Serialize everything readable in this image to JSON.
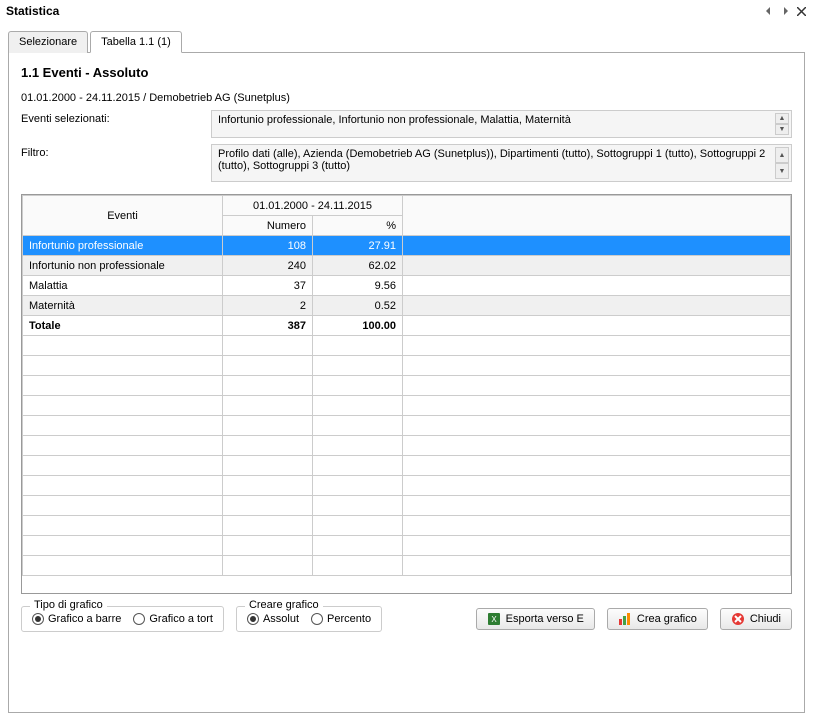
{
  "window": {
    "title": "Statistica"
  },
  "tabs": [
    {
      "label": "Selezionare",
      "active": false
    },
    {
      "label": "Tabella 1.1 (1)",
      "active": true
    }
  ],
  "section_title": "1.1 Eventi - Assoluto",
  "date_range_meta": "01.01.2000 - 24.11.2015 / Demobetrieb AG (Sunetplus)",
  "labels": {
    "eventi_selezionati": "Eventi selezionati:",
    "filtro": "Filtro:"
  },
  "eventi_selezionati_value": "Infortunio professionale, Infortunio non professionale, Malattia, Maternità",
  "filtro_value": "Profilo dati (alle), Azienda (Demobetrieb AG (Sunetplus)), Dipartimenti (tutto), Sottogruppi 1 (tutto), Sottogruppi 2 (tutto), Sottogruppi 3 (tutto)",
  "table": {
    "header_events": "Eventi",
    "header_period": "01.01.2000 - 24.11.2015",
    "header_numero": "Numero",
    "header_pct": "%",
    "rows": [
      {
        "label": "Infortunio professionale",
        "numero": "108",
        "pct": "27.91",
        "selected": true
      },
      {
        "label": "Infortunio non professionale",
        "numero": "240",
        "pct": "62.02",
        "alt": true
      },
      {
        "label": "Malattia",
        "numero": "37",
        "pct": "9.56"
      },
      {
        "label": "Maternità",
        "numero": "2",
        "pct": "0.52",
        "alt": true
      }
    ],
    "total": {
      "label": "Totale",
      "numero": "387",
      "pct": "100.00"
    },
    "empty_rows": 12
  },
  "chart_data": {
    "type": "table",
    "title": "1.1 Eventi - Assoluto",
    "period": "01.01.2000 - 24.11.2015",
    "categories": [
      "Infortunio professionale",
      "Infortunio non professionale",
      "Malattia",
      "Maternità"
    ],
    "series": [
      {
        "name": "Numero",
        "values": [
          108,
          240,
          37,
          2
        ]
      },
      {
        "name": "%",
        "values": [
          27.91,
          62.02,
          9.56,
          0.52
        ]
      }
    ],
    "total": {
      "Numero": 387,
      "%": 100.0
    }
  },
  "groups": {
    "tipo_title": "Tipo di grafico",
    "tipo_options": [
      {
        "label": "Grafico a barre",
        "checked": true
      },
      {
        "label": "Grafico a tort",
        "checked": false
      }
    ],
    "creare_title": "Creare grafico",
    "creare_options": [
      {
        "label": "Assolut",
        "checked": true
      },
      {
        "label": "Percento",
        "checked": false
      }
    ]
  },
  "buttons": {
    "esporta": "Esporta verso E",
    "crea": "Crea grafico",
    "chiudi": "Chiudi"
  }
}
